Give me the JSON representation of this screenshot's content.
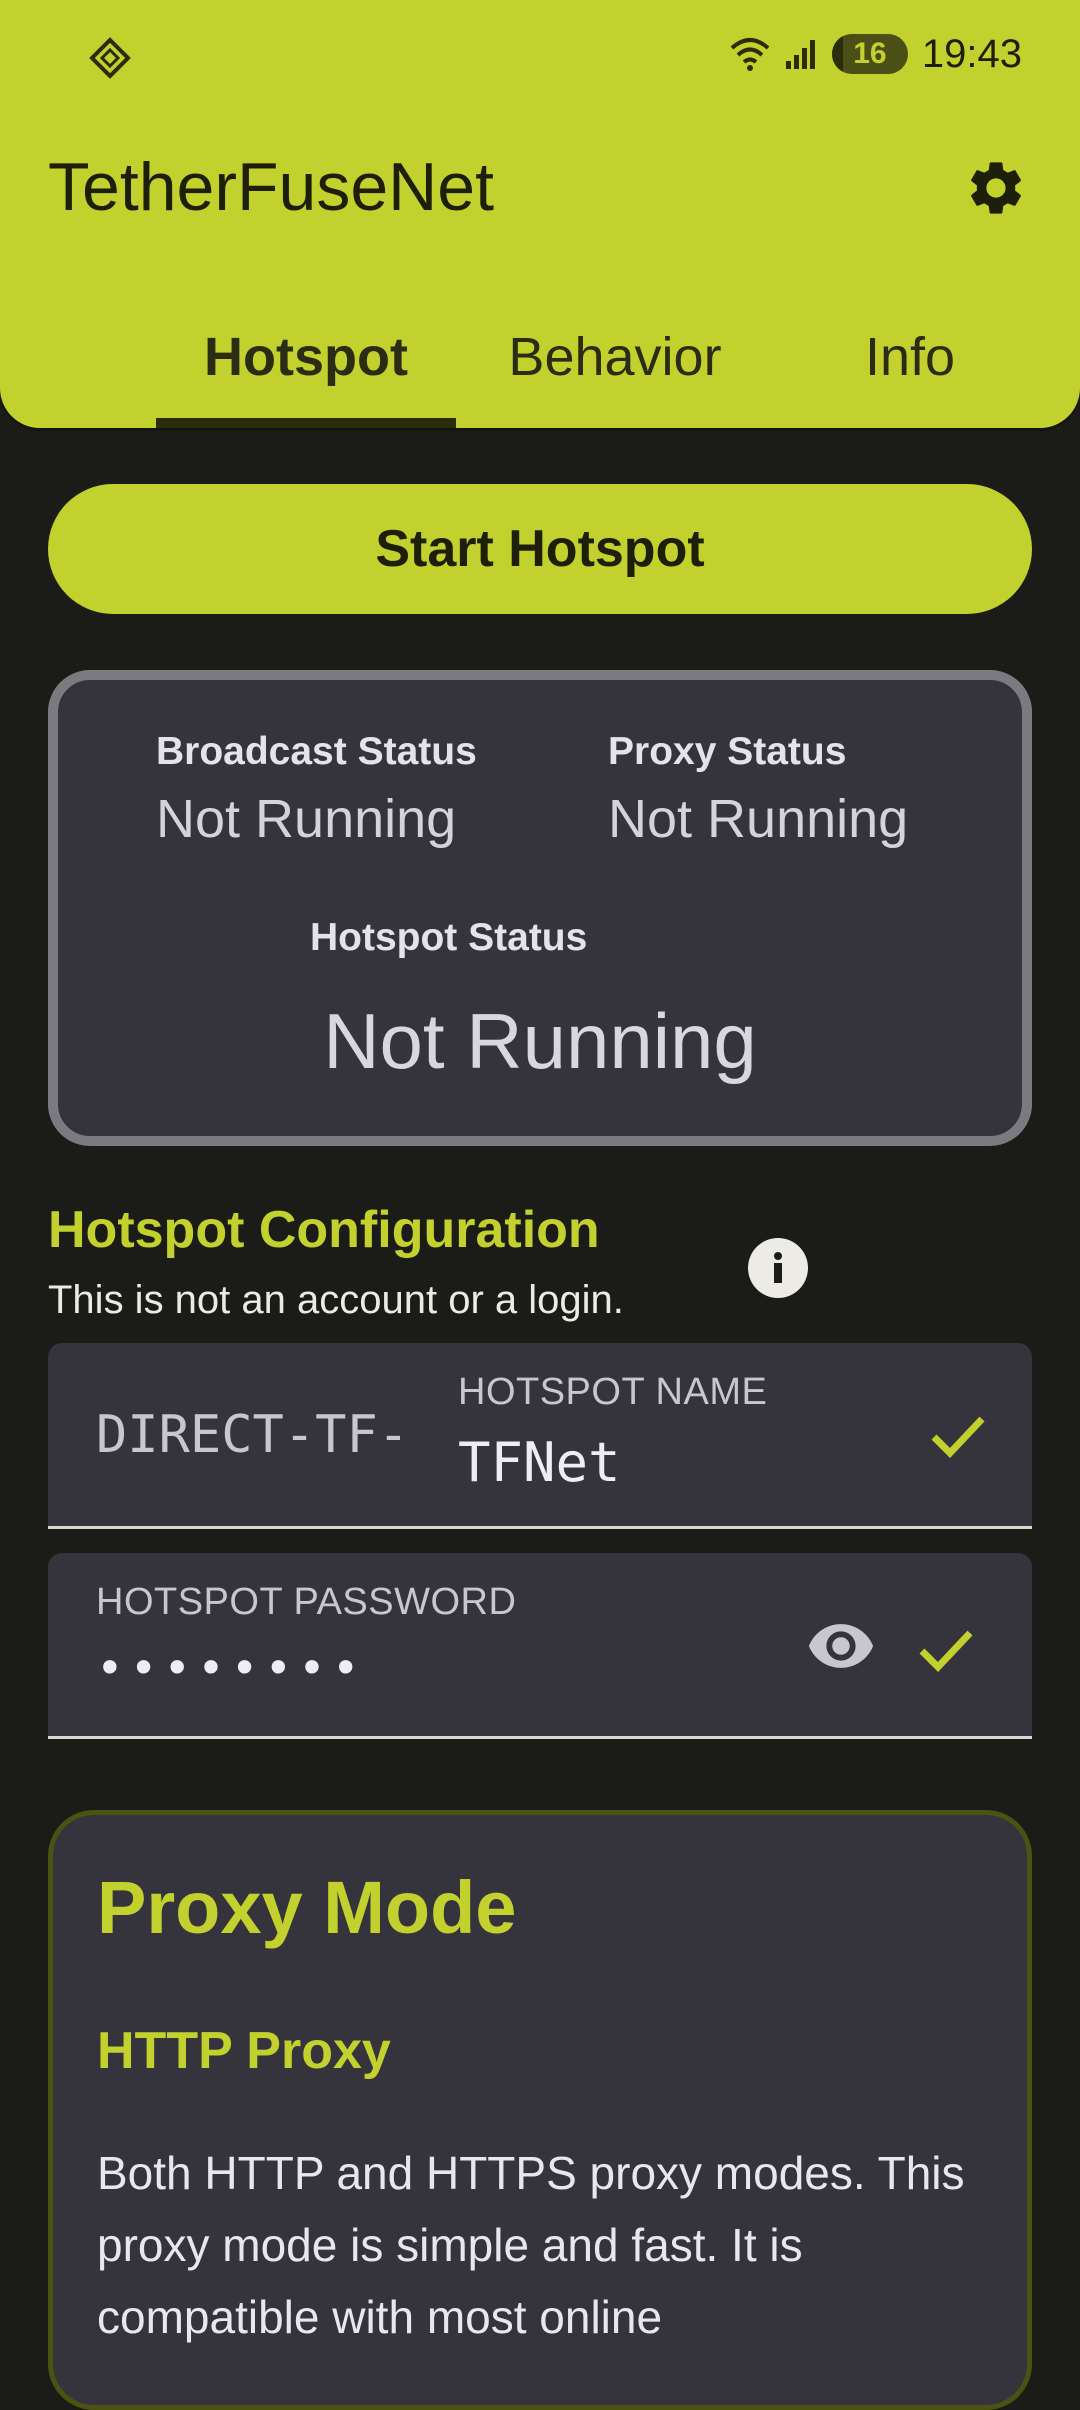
{
  "colors": {
    "accent": "#c3d12e",
    "background": "#1b1c18",
    "card": "#35343c"
  },
  "status_bar": {
    "left_icon": "app-notification-icon",
    "battery": "16",
    "time": "19:43"
  },
  "app": {
    "title": "TetherFuseNet"
  },
  "tabs": [
    {
      "label": "Hotspot",
      "active": true
    },
    {
      "label": "Behavior",
      "active": false
    },
    {
      "label": "Info",
      "active": false
    }
  ],
  "actions": {
    "start_label": "Start Hotspot"
  },
  "status_card": {
    "broadcast_label": "Broadcast Status",
    "broadcast_value": "Not Running",
    "proxy_label": "Proxy Status",
    "proxy_value": "Not Running",
    "hotspot_label": "Hotspot Status",
    "hotspot_value": "Not Running"
  },
  "config": {
    "title": "Hotspot Configuration",
    "subtitle": "This is not an account or a login.",
    "name_prefix": "DIRECT-TF-",
    "name_label": "HOTSPOT NAME",
    "name_value": "TFNet",
    "password_label": "HOTSPOT PASSWORD",
    "password_value": "••••••••"
  },
  "proxy": {
    "title": "Proxy Mode",
    "mode": "HTTP Proxy",
    "description": "Both HTTP and HTTPS proxy modes. This proxy mode is simple and fast. It is compatible with most online"
  }
}
